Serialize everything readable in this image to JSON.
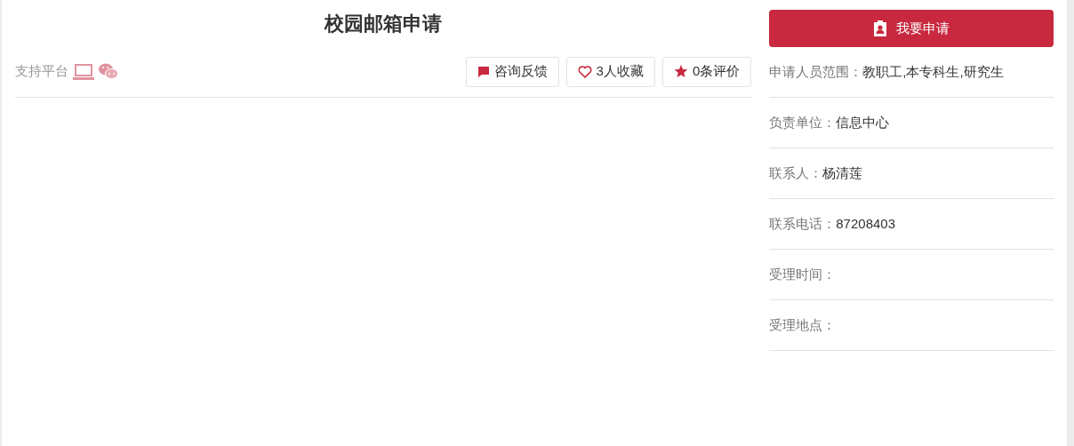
{
  "title": "校园邮箱申请",
  "platform": {
    "label": "支持平台"
  },
  "actions": [
    {
      "kind": "feedback",
      "label": "咨询反馈"
    },
    {
      "kind": "favorite",
      "label": "3人收藏"
    },
    {
      "kind": "review",
      "label": "0条评价"
    }
  ],
  "apply_button": {
    "label": "我要申请"
  },
  "info": [
    {
      "label": "申请人员范围：",
      "value": "教职工,本专科生,研究生"
    },
    {
      "label": "负责单位：",
      "value": "信息中心"
    },
    {
      "label": "联系人：",
      "value": "杨清莲"
    },
    {
      "label": "联系电话：",
      "value": "87208403"
    },
    {
      "label": "受理时间："
    },
    {
      "label": "受理地点："
    }
  ]
}
